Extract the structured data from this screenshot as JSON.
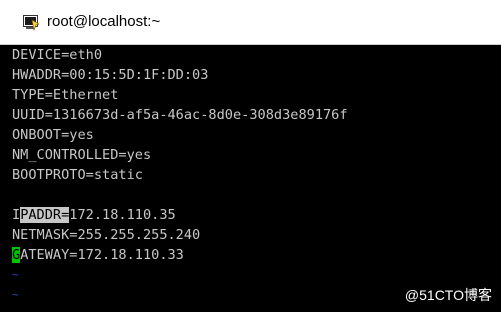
{
  "window": {
    "title": "root@localhost:~",
    "icon": "putty-terminal-icon"
  },
  "terminal": {
    "lines": [
      "DEVICE=eth0",
      "HWADDR=00:15:5D:1F:DD:03",
      "TYPE=Ethernet",
      "UUID=1316673d-af5a-46ac-8d0e-308d3e89176f",
      "ONBOOT=yes",
      "NM_CONTROLLED=yes",
      "BOOTPROTO=static",
      ""
    ],
    "ipaddr": {
      "first_char": "I",
      "selected": "PADDR=",
      "value": "172.18.110.35"
    },
    "netmask": "NETMASK=255.255.255.240",
    "gateway": {
      "cursor_char": "G",
      "rest": "ATEWAY=172.18.110.33"
    },
    "tildes": [
      "~",
      "~"
    ]
  },
  "watermark": "@51CTO博客",
  "colors": {
    "terminal_bg": "#000000",
    "terminal_fg": "#c7c7c7",
    "cursor": "#00c400",
    "tilde": "#2a49c6"
  }
}
